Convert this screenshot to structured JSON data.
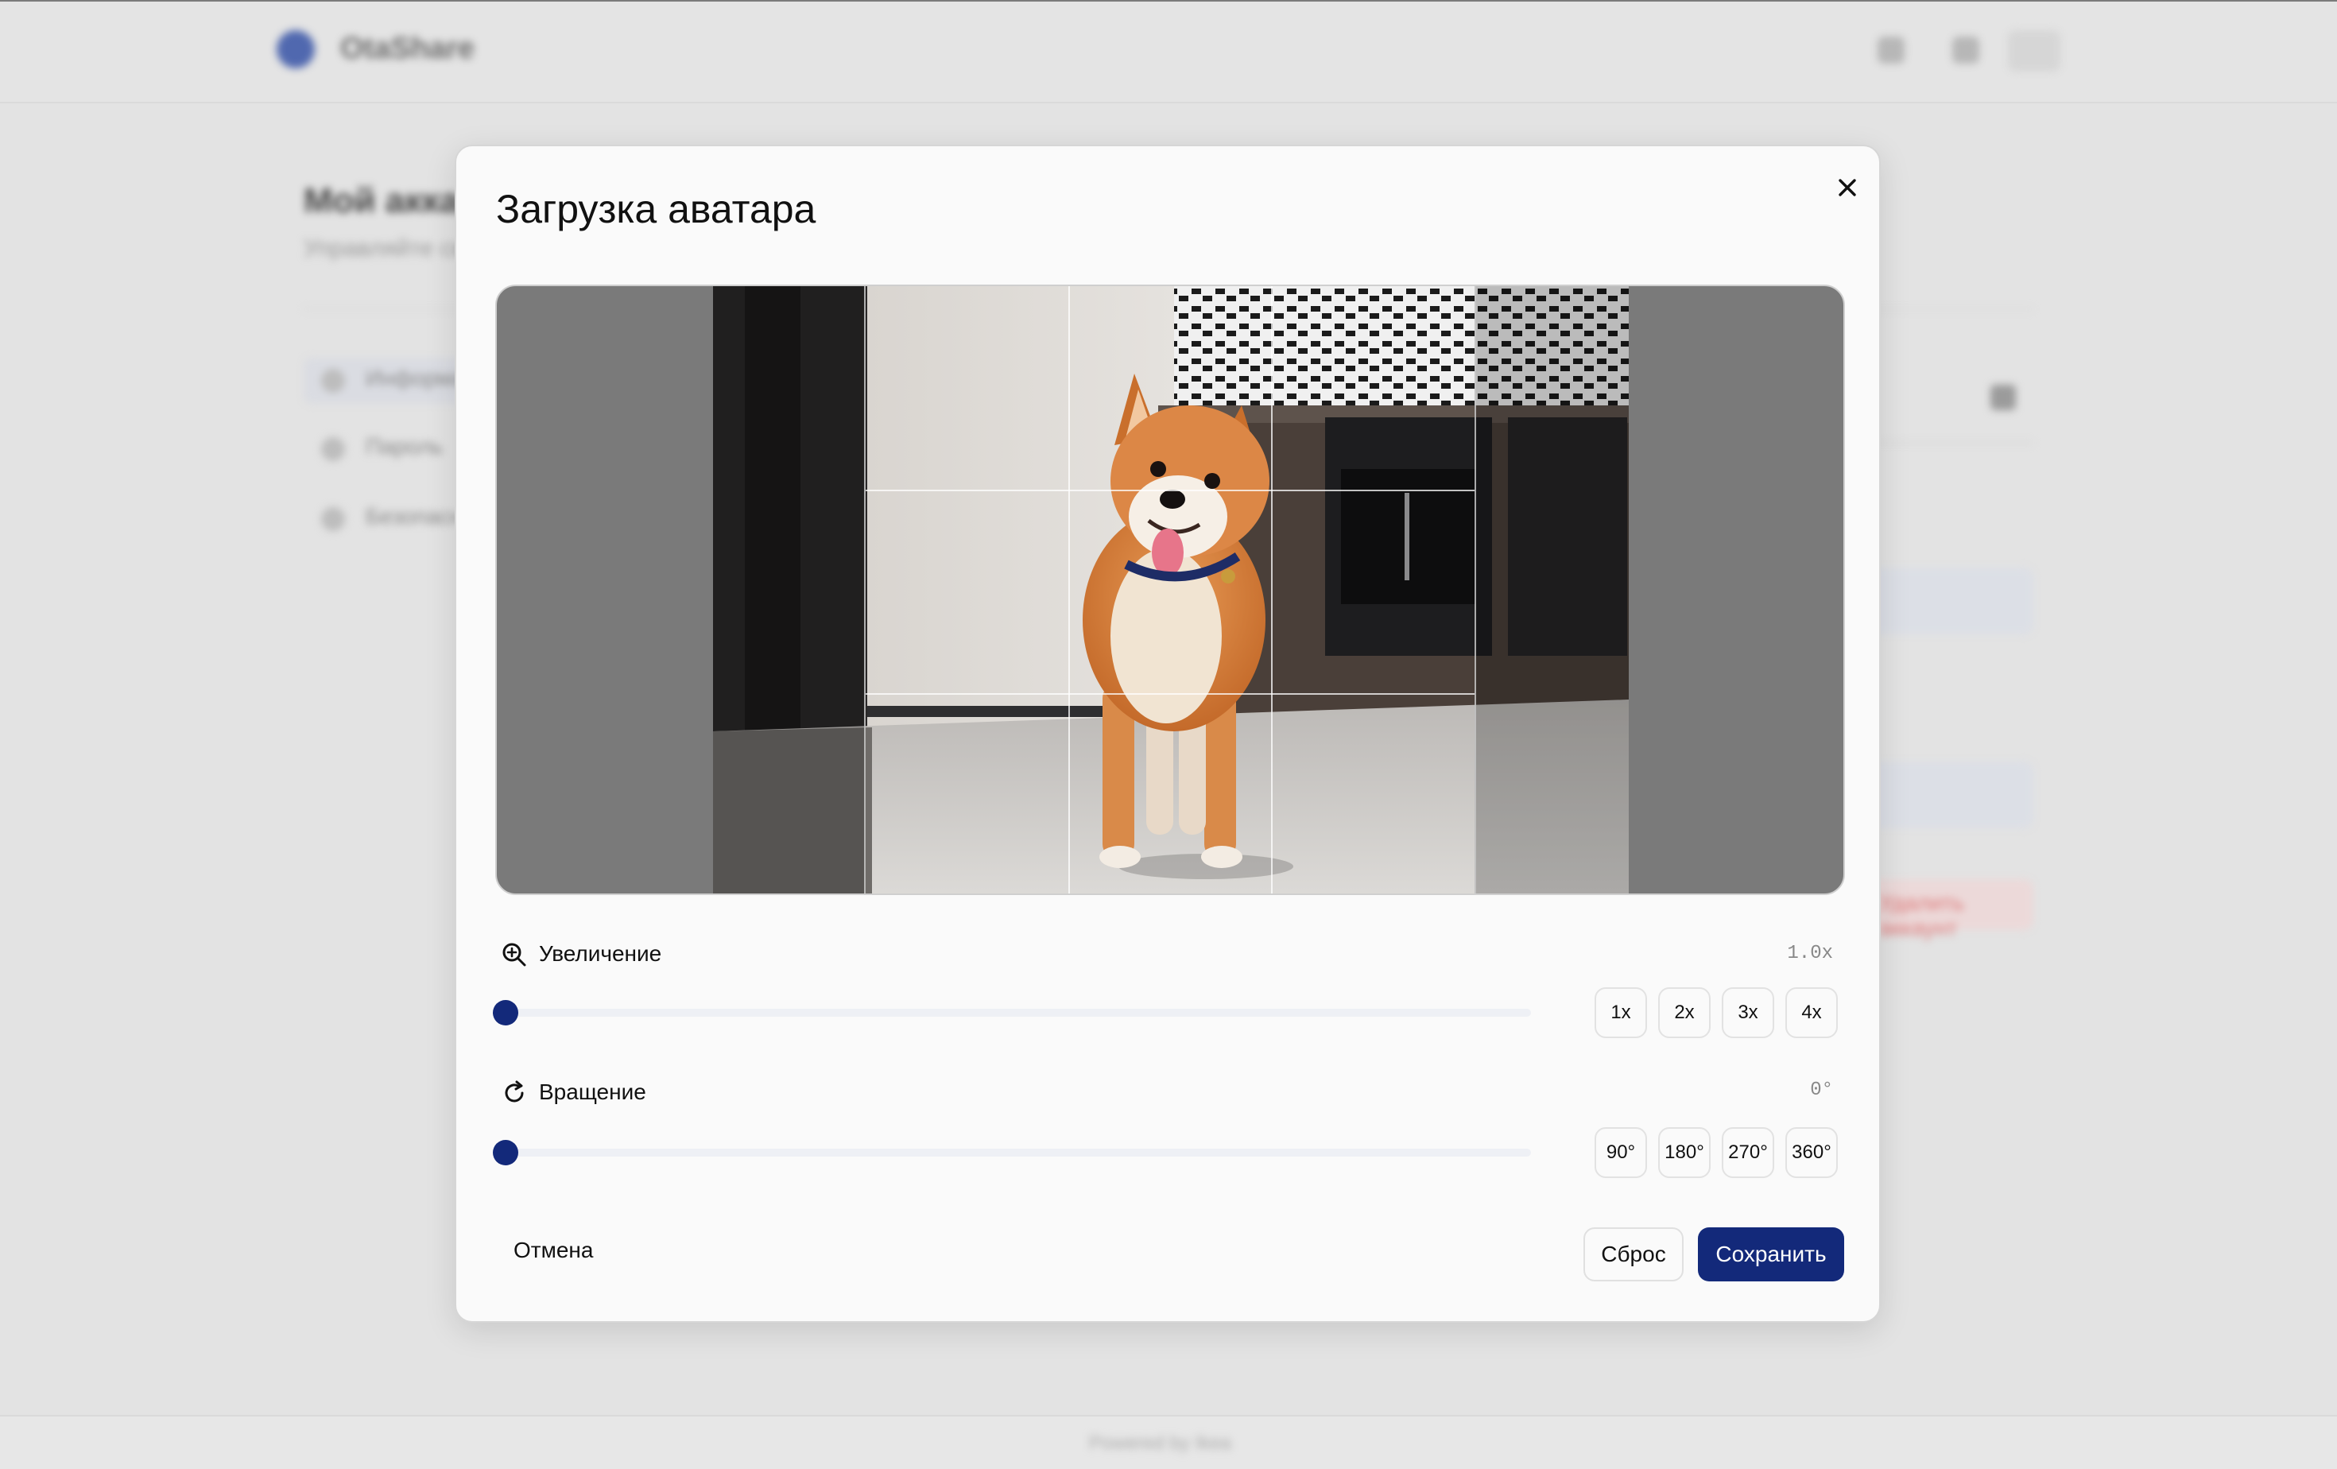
{
  "background": {
    "brand": "OtaShare",
    "page_title": "Мой аккаунт",
    "page_subtitle": "Управляйте своим аккаунтом",
    "nav_items": [
      "Информация",
      "Пароль",
      "Безопасность"
    ],
    "danger_label": "Удалить аккаунт",
    "footer": "Powered by Ikea"
  },
  "modal": {
    "title": "Загрузка аватара",
    "close_icon": "close-icon",
    "zoom": {
      "label": "Увеличение",
      "icon": "zoom-in-icon",
      "value_text": "1.0x",
      "value": 1.0,
      "min": 1,
      "max": 4,
      "presets": [
        "1x",
        "2x",
        "3x",
        "4x"
      ]
    },
    "rotation": {
      "label": "Вращение",
      "icon": "rotate-icon",
      "value_text": "0°",
      "value": 0,
      "min": 0,
      "max": 360,
      "presets": [
        "90°",
        "180°",
        "270°",
        "360°"
      ]
    },
    "cancel_label": "Отмена",
    "reset_label": "Сброс",
    "save_label": "Сохранить"
  },
  "colors": {
    "accent": "#13297a",
    "backdrop": "#e3e3e3",
    "crop_outside": "#7a7a7a"
  }
}
